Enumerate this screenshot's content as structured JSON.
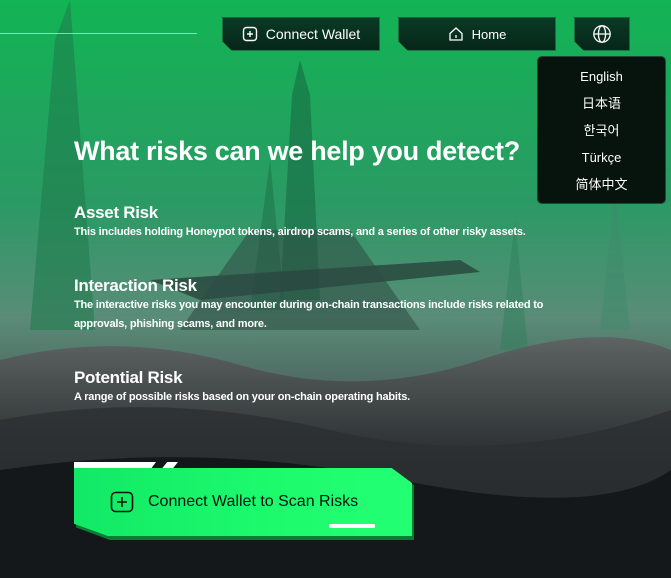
{
  "nav": {
    "connect_wallet": "Connect Wallet",
    "home": "Home"
  },
  "language_menu": {
    "items": [
      "English",
      "日本语",
      "한국어",
      "Türkçe",
      "简体中文"
    ]
  },
  "headline": "What risks can we help you detect?",
  "risks": [
    {
      "title": "Asset Risk",
      "description": "This includes holding Honeypot tokens, airdrop scams, and a series of other risky assets."
    },
    {
      "title": "Interaction Risk",
      "description": "The interactive risks you may encounter during on-chain transactions include risks related to approvals, phishing scams, and more."
    },
    {
      "title": "Potential Risk",
      "description": "A range of possible risks based on your on-chain operating habits."
    }
  ],
  "cta": {
    "label": "Connect Wallet to Scan Risks"
  },
  "colors": {
    "accent": "#1dfb6d",
    "nav_bg": "#0b3a25",
    "sky_top": "#0fa84f"
  },
  "icons": {
    "wallet": "wallet-icon",
    "home": "home-icon",
    "globe": "globe-icon",
    "cta": "plus-wallet-icon"
  }
}
